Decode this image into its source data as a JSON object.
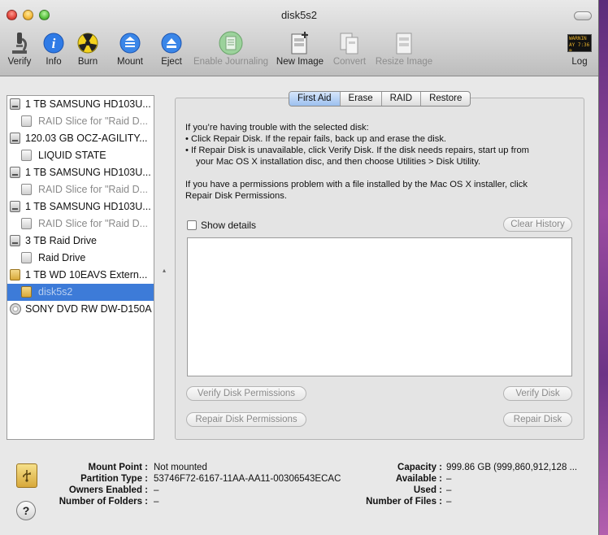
{
  "window": {
    "title": "disk5s2"
  },
  "toolbar": {
    "verify": "Verify",
    "info": "Info",
    "burn": "Burn",
    "mount": "Mount",
    "eject": "Eject",
    "enable_journaling": "Enable Journaling",
    "new_image": "New Image",
    "convert": "Convert",
    "resize_image": "Resize Image",
    "log": "Log",
    "log_icon_text_1": "WARNIN",
    "log_icon_text_2": "AY 7:36 P"
  },
  "sidebar": {
    "items": [
      {
        "label": "1 TB SAMSUNG HD103U...",
        "level": 1,
        "state": "normal",
        "icon": "hard-drive"
      },
      {
        "label": "RAID Slice for \"Raid D...",
        "level": 2,
        "state": "grey",
        "icon": "volume"
      },
      {
        "label": "120.03 GB OCZ-AGILITY...",
        "level": 1,
        "state": "normal",
        "icon": "hard-drive"
      },
      {
        "label": "LIQUID STATE",
        "level": 2,
        "state": "normal",
        "icon": "volume"
      },
      {
        "label": "1 TB SAMSUNG HD103U...",
        "level": 1,
        "state": "normal",
        "icon": "hard-drive"
      },
      {
        "label": "RAID Slice for \"Raid D...",
        "level": 2,
        "state": "grey",
        "icon": "volume"
      },
      {
        "label": "1 TB SAMSUNG HD103U...",
        "level": 1,
        "state": "normal",
        "icon": "hard-drive"
      },
      {
        "label": "RAID Slice for \"Raid D...",
        "level": 2,
        "state": "grey",
        "icon": "volume"
      },
      {
        "label": "3 TB Raid Drive",
        "level": 1,
        "state": "normal",
        "icon": "raid"
      },
      {
        "label": "Raid Drive",
        "level": 2,
        "state": "normal",
        "icon": "volume"
      },
      {
        "label": "1 TB WD 10EAVS Extern...",
        "level": 1,
        "state": "normal",
        "icon": "external-drive"
      },
      {
        "label": "disk5s2",
        "level": 2,
        "state": "selected",
        "icon": "external-volume"
      },
      {
        "label": "SONY DVD RW DW-D150A",
        "level": 1,
        "state": "normal",
        "icon": "optical"
      }
    ]
  },
  "tabs": [
    {
      "label": "First Aid",
      "active": true
    },
    {
      "label": "Erase",
      "active": false
    },
    {
      "label": "RAID",
      "active": false
    },
    {
      "label": "Restore",
      "active": false
    }
  ],
  "first_aid": {
    "intro": "If you’re having trouble with the selected disk:",
    "bullet1": "• Click Repair Disk. If the repair fails, back up and erase the disk.",
    "bullet2a": "• If Repair Disk is unavailable, click Verify Disk. If the disk needs repairs, start up from",
    "bullet2b": "your Mac OS X installation disc, and then choose Utilities > Disk Utility.",
    "perm1": "If you have a permissions problem with a file installed by the Mac OS X installer, click",
    "perm2": "Repair Disk Permissions.",
    "show_details": "Show details",
    "clear_history": "Clear History",
    "verify_permissions": "Verify Disk Permissions",
    "repair_permissions": "Repair Disk Permissions",
    "verify_disk": "Verify Disk",
    "repair_disk": "Repair Disk"
  },
  "info": {
    "mount_point_label": "Mount Point :",
    "mount_point_value": "Not mounted",
    "partition_type_label": "Partition Type :",
    "partition_type_value": "53746F72-6167-11AA-AA11-00306543ECAC",
    "owners_enabled_label": "Owners Enabled :",
    "owners_enabled_value": "–",
    "number_of_folders_label": "Number of Folders :",
    "number_of_folders_value": "–",
    "capacity_label": "Capacity :",
    "capacity_value": "999.86 GB (999,860,912,128 ...",
    "available_label": "Available :",
    "available_value": "–",
    "used_label": "Used :",
    "used_value": "–",
    "number_of_files_label": "Number of Files :",
    "number_of_files_value": "–",
    "help": "?"
  }
}
